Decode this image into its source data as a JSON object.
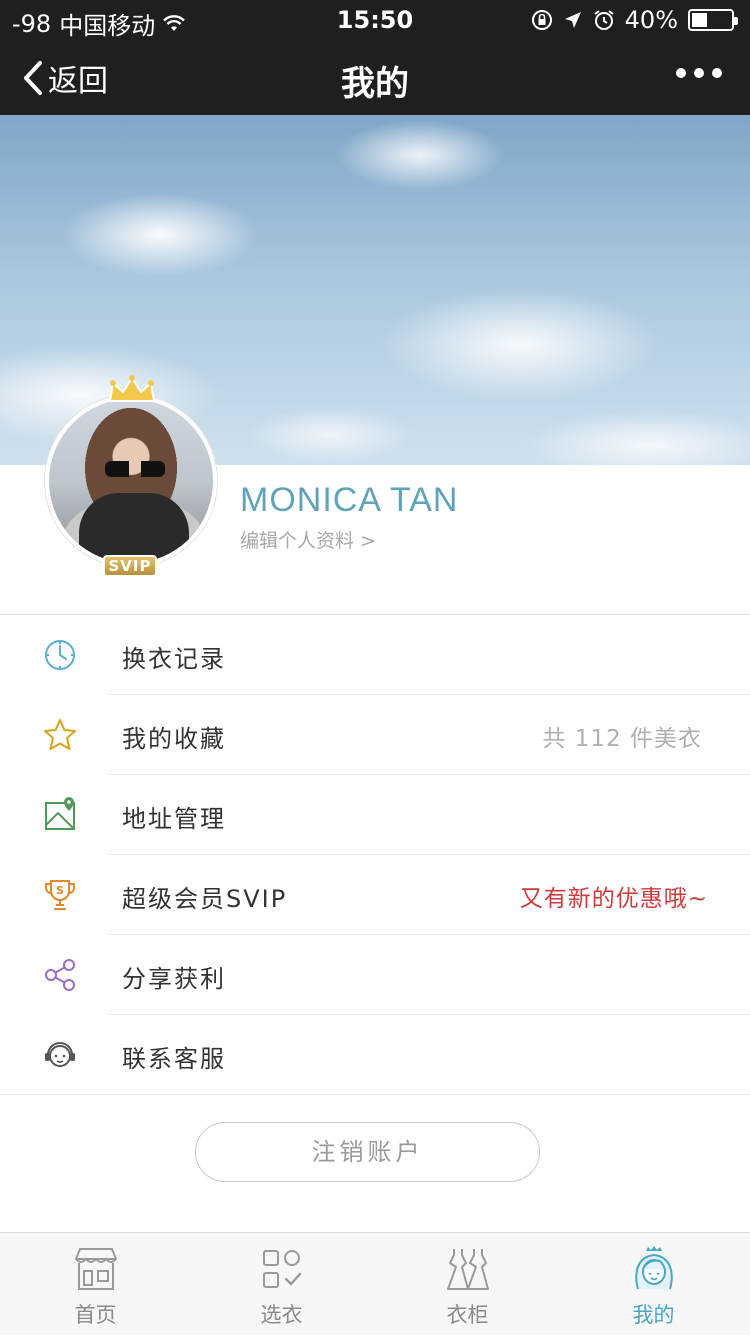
{
  "status_bar": {
    "signal": "-98",
    "carrier": "中国移动",
    "time": "15:50",
    "battery_percent": "40%",
    "battery_level": 0.4,
    "icons": [
      "wifi-icon",
      "lock-rotation-icon",
      "location-icon",
      "alarm-icon",
      "battery-icon"
    ]
  },
  "nav": {
    "back_label": "返回",
    "title": "我的",
    "more_icon": "more-dots-icon"
  },
  "profile": {
    "name": "MONICA TAN",
    "edit_link": "编辑个人资料 >",
    "badge": "SVIP",
    "crown_icon": "crown-icon"
  },
  "menu": [
    {
      "label": "换衣记录",
      "value": "",
      "icon": "clock-icon",
      "color": "#5aaed0"
    },
    {
      "label": "我的收藏",
      "value": "共 112 件美衣",
      "icon": "star-icon",
      "color": "#d9a21b"
    },
    {
      "label": "地址管理",
      "value": "",
      "icon": "map-pin-icon",
      "color": "#4f9a5b"
    },
    {
      "label": "超级会员SVIP",
      "value": "又有新的优惠哦~",
      "icon": "trophy-icon",
      "color": "#e08a2c"
    },
    {
      "label": "分享获利",
      "value": "",
      "icon": "share-icon",
      "color": "#9a6bc7"
    },
    {
      "label": "联系客服",
      "value": "",
      "icon": "headset-icon",
      "color": "#555555"
    }
  ],
  "logout_label": "注销账户",
  "tabs": [
    {
      "label": "首页",
      "icon": "store-icon",
      "active": false
    },
    {
      "label": "选衣",
      "icon": "grid-check-icon",
      "active": false
    },
    {
      "label": "衣柜",
      "icon": "dresses-icon",
      "active": false
    },
    {
      "label": "我的",
      "icon": "princess-icon",
      "active": true
    }
  ],
  "colors": {
    "bar_bg": "#1f1f1f",
    "accent": "#4aa7c6",
    "name": "#5fa3bb",
    "promo": "#d03b3b"
  }
}
